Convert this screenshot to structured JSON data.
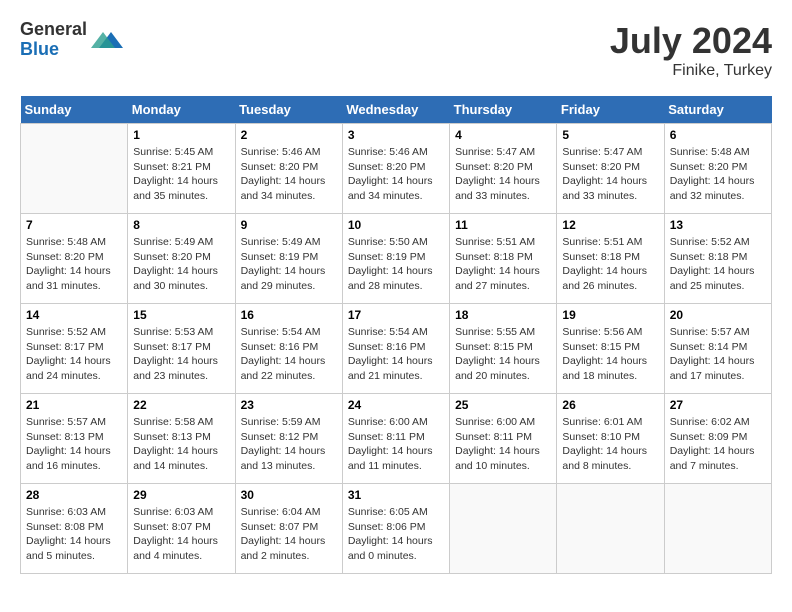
{
  "header": {
    "logo_general": "General",
    "logo_blue": "Blue",
    "month_year": "July 2024",
    "location": "Finike, Turkey"
  },
  "weekdays": [
    "Sunday",
    "Monday",
    "Tuesday",
    "Wednesday",
    "Thursday",
    "Friday",
    "Saturday"
  ],
  "weeks": [
    [
      {
        "day": "",
        "info": ""
      },
      {
        "day": "1",
        "info": "Sunrise: 5:45 AM\nSunset: 8:21 PM\nDaylight: 14 hours\nand 35 minutes."
      },
      {
        "day": "2",
        "info": "Sunrise: 5:46 AM\nSunset: 8:20 PM\nDaylight: 14 hours\nand 34 minutes."
      },
      {
        "day": "3",
        "info": "Sunrise: 5:46 AM\nSunset: 8:20 PM\nDaylight: 14 hours\nand 34 minutes."
      },
      {
        "day": "4",
        "info": "Sunrise: 5:47 AM\nSunset: 8:20 PM\nDaylight: 14 hours\nand 33 minutes."
      },
      {
        "day": "5",
        "info": "Sunrise: 5:47 AM\nSunset: 8:20 PM\nDaylight: 14 hours\nand 33 minutes."
      },
      {
        "day": "6",
        "info": "Sunrise: 5:48 AM\nSunset: 8:20 PM\nDaylight: 14 hours\nand 32 minutes."
      }
    ],
    [
      {
        "day": "7",
        "info": "Sunrise: 5:48 AM\nSunset: 8:20 PM\nDaylight: 14 hours\nand 31 minutes."
      },
      {
        "day": "8",
        "info": "Sunrise: 5:49 AM\nSunset: 8:20 PM\nDaylight: 14 hours\nand 30 minutes."
      },
      {
        "day": "9",
        "info": "Sunrise: 5:49 AM\nSunset: 8:19 PM\nDaylight: 14 hours\nand 29 minutes."
      },
      {
        "day": "10",
        "info": "Sunrise: 5:50 AM\nSunset: 8:19 PM\nDaylight: 14 hours\nand 28 minutes."
      },
      {
        "day": "11",
        "info": "Sunrise: 5:51 AM\nSunset: 8:18 PM\nDaylight: 14 hours\nand 27 minutes."
      },
      {
        "day": "12",
        "info": "Sunrise: 5:51 AM\nSunset: 8:18 PM\nDaylight: 14 hours\nand 26 minutes."
      },
      {
        "day": "13",
        "info": "Sunrise: 5:52 AM\nSunset: 8:18 PM\nDaylight: 14 hours\nand 25 minutes."
      }
    ],
    [
      {
        "day": "14",
        "info": "Sunrise: 5:52 AM\nSunset: 8:17 PM\nDaylight: 14 hours\nand 24 minutes."
      },
      {
        "day": "15",
        "info": "Sunrise: 5:53 AM\nSunset: 8:17 PM\nDaylight: 14 hours\nand 23 minutes."
      },
      {
        "day": "16",
        "info": "Sunrise: 5:54 AM\nSunset: 8:16 PM\nDaylight: 14 hours\nand 22 minutes."
      },
      {
        "day": "17",
        "info": "Sunrise: 5:54 AM\nSunset: 8:16 PM\nDaylight: 14 hours\nand 21 minutes."
      },
      {
        "day": "18",
        "info": "Sunrise: 5:55 AM\nSunset: 8:15 PM\nDaylight: 14 hours\nand 20 minutes."
      },
      {
        "day": "19",
        "info": "Sunrise: 5:56 AM\nSunset: 8:15 PM\nDaylight: 14 hours\nand 18 minutes."
      },
      {
        "day": "20",
        "info": "Sunrise: 5:57 AM\nSunset: 8:14 PM\nDaylight: 14 hours\nand 17 minutes."
      }
    ],
    [
      {
        "day": "21",
        "info": "Sunrise: 5:57 AM\nSunset: 8:13 PM\nDaylight: 14 hours\nand 16 minutes."
      },
      {
        "day": "22",
        "info": "Sunrise: 5:58 AM\nSunset: 8:13 PM\nDaylight: 14 hours\nand 14 minutes."
      },
      {
        "day": "23",
        "info": "Sunrise: 5:59 AM\nSunset: 8:12 PM\nDaylight: 14 hours\nand 13 minutes."
      },
      {
        "day": "24",
        "info": "Sunrise: 6:00 AM\nSunset: 8:11 PM\nDaylight: 14 hours\nand 11 minutes."
      },
      {
        "day": "25",
        "info": "Sunrise: 6:00 AM\nSunset: 8:11 PM\nDaylight: 14 hours\nand 10 minutes."
      },
      {
        "day": "26",
        "info": "Sunrise: 6:01 AM\nSunset: 8:10 PM\nDaylight: 14 hours\nand 8 minutes."
      },
      {
        "day": "27",
        "info": "Sunrise: 6:02 AM\nSunset: 8:09 PM\nDaylight: 14 hours\nand 7 minutes."
      }
    ],
    [
      {
        "day": "28",
        "info": "Sunrise: 6:03 AM\nSunset: 8:08 PM\nDaylight: 14 hours\nand 5 minutes."
      },
      {
        "day": "29",
        "info": "Sunrise: 6:03 AM\nSunset: 8:07 PM\nDaylight: 14 hours\nand 4 minutes."
      },
      {
        "day": "30",
        "info": "Sunrise: 6:04 AM\nSunset: 8:07 PM\nDaylight: 14 hours\nand 2 minutes."
      },
      {
        "day": "31",
        "info": "Sunrise: 6:05 AM\nSunset: 8:06 PM\nDaylight: 14 hours\nand 0 minutes."
      },
      {
        "day": "",
        "info": ""
      },
      {
        "day": "",
        "info": ""
      },
      {
        "day": "",
        "info": ""
      }
    ]
  ]
}
